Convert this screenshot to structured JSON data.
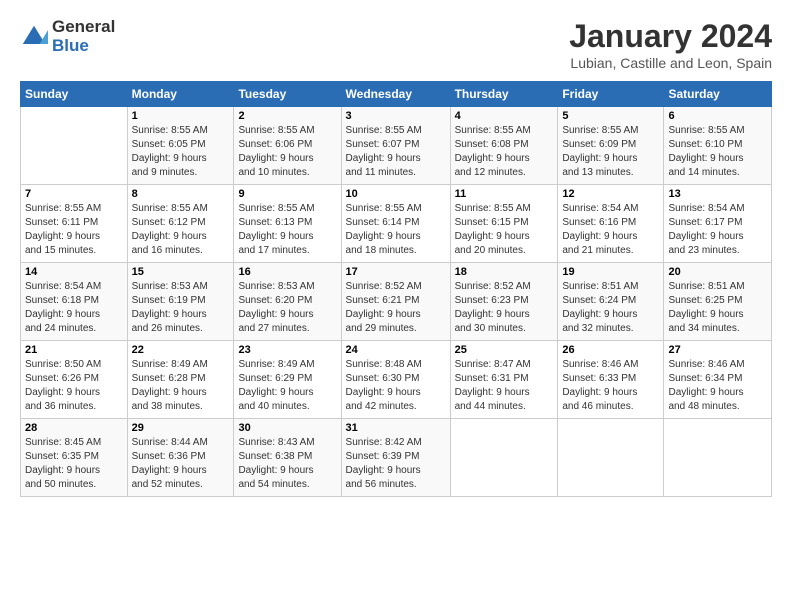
{
  "header": {
    "logo_general": "General",
    "logo_blue": "Blue",
    "title": "January 2024",
    "subtitle": "Lubian, Castille and Leon, Spain"
  },
  "weekdays": [
    "Sunday",
    "Monday",
    "Tuesday",
    "Wednesday",
    "Thursday",
    "Friday",
    "Saturday"
  ],
  "weeks": [
    [
      {
        "day": "",
        "info": ""
      },
      {
        "day": "1",
        "info": "Sunrise: 8:55 AM\nSunset: 6:05 PM\nDaylight: 9 hours\nand 9 minutes."
      },
      {
        "day": "2",
        "info": "Sunrise: 8:55 AM\nSunset: 6:06 PM\nDaylight: 9 hours\nand 10 minutes."
      },
      {
        "day": "3",
        "info": "Sunrise: 8:55 AM\nSunset: 6:07 PM\nDaylight: 9 hours\nand 11 minutes."
      },
      {
        "day": "4",
        "info": "Sunrise: 8:55 AM\nSunset: 6:08 PM\nDaylight: 9 hours\nand 12 minutes."
      },
      {
        "day": "5",
        "info": "Sunrise: 8:55 AM\nSunset: 6:09 PM\nDaylight: 9 hours\nand 13 minutes."
      },
      {
        "day": "6",
        "info": "Sunrise: 8:55 AM\nSunset: 6:10 PM\nDaylight: 9 hours\nand 14 minutes."
      }
    ],
    [
      {
        "day": "7",
        "info": "Sunrise: 8:55 AM\nSunset: 6:11 PM\nDaylight: 9 hours\nand 15 minutes."
      },
      {
        "day": "8",
        "info": "Sunrise: 8:55 AM\nSunset: 6:12 PM\nDaylight: 9 hours\nand 16 minutes."
      },
      {
        "day": "9",
        "info": "Sunrise: 8:55 AM\nSunset: 6:13 PM\nDaylight: 9 hours\nand 17 minutes."
      },
      {
        "day": "10",
        "info": "Sunrise: 8:55 AM\nSunset: 6:14 PM\nDaylight: 9 hours\nand 18 minutes."
      },
      {
        "day": "11",
        "info": "Sunrise: 8:55 AM\nSunset: 6:15 PM\nDaylight: 9 hours\nand 20 minutes."
      },
      {
        "day": "12",
        "info": "Sunrise: 8:54 AM\nSunset: 6:16 PM\nDaylight: 9 hours\nand 21 minutes."
      },
      {
        "day": "13",
        "info": "Sunrise: 8:54 AM\nSunset: 6:17 PM\nDaylight: 9 hours\nand 23 minutes."
      }
    ],
    [
      {
        "day": "14",
        "info": "Sunrise: 8:54 AM\nSunset: 6:18 PM\nDaylight: 9 hours\nand 24 minutes."
      },
      {
        "day": "15",
        "info": "Sunrise: 8:53 AM\nSunset: 6:19 PM\nDaylight: 9 hours\nand 26 minutes."
      },
      {
        "day": "16",
        "info": "Sunrise: 8:53 AM\nSunset: 6:20 PM\nDaylight: 9 hours\nand 27 minutes."
      },
      {
        "day": "17",
        "info": "Sunrise: 8:52 AM\nSunset: 6:21 PM\nDaylight: 9 hours\nand 29 minutes."
      },
      {
        "day": "18",
        "info": "Sunrise: 8:52 AM\nSunset: 6:23 PM\nDaylight: 9 hours\nand 30 minutes."
      },
      {
        "day": "19",
        "info": "Sunrise: 8:51 AM\nSunset: 6:24 PM\nDaylight: 9 hours\nand 32 minutes."
      },
      {
        "day": "20",
        "info": "Sunrise: 8:51 AM\nSunset: 6:25 PM\nDaylight: 9 hours\nand 34 minutes."
      }
    ],
    [
      {
        "day": "21",
        "info": "Sunrise: 8:50 AM\nSunset: 6:26 PM\nDaylight: 9 hours\nand 36 minutes."
      },
      {
        "day": "22",
        "info": "Sunrise: 8:49 AM\nSunset: 6:28 PM\nDaylight: 9 hours\nand 38 minutes."
      },
      {
        "day": "23",
        "info": "Sunrise: 8:49 AM\nSunset: 6:29 PM\nDaylight: 9 hours\nand 40 minutes."
      },
      {
        "day": "24",
        "info": "Sunrise: 8:48 AM\nSunset: 6:30 PM\nDaylight: 9 hours\nand 42 minutes."
      },
      {
        "day": "25",
        "info": "Sunrise: 8:47 AM\nSunset: 6:31 PM\nDaylight: 9 hours\nand 44 minutes."
      },
      {
        "day": "26",
        "info": "Sunrise: 8:46 AM\nSunset: 6:33 PM\nDaylight: 9 hours\nand 46 minutes."
      },
      {
        "day": "27",
        "info": "Sunrise: 8:46 AM\nSunset: 6:34 PM\nDaylight: 9 hours\nand 48 minutes."
      }
    ],
    [
      {
        "day": "28",
        "info": "Sunrise: 8:45 AM\nSunset: 6:35 PM\nDaylight: 9 hours\nand 50 minutes."
      },
      {
        "day": "29",
        "info": "Sunrise: 8:44 AM\nSunset: 6:36 PM\nDaylight: 9 hours\nand 52 minutes."
      },
      {
        "day": "30",
        "info": "Sunrise: 8:43 AM\nSunset: 6:38 PM\nDaylight: 9 hours\nand 54 minutes."
      },
      {
        "day": "31",
        "info": "Sunrise: 8:42 AM\nSunset: 6:39 PM\nDaylight: 9 hours\nand 56 minutes."
      },
      {
        "day": "",
        "info": ""
      },
      {
        "day": "",
        "info": ""
      },
      {
        "day": "",
        "info": ""
      }
    ]
  ]
}
